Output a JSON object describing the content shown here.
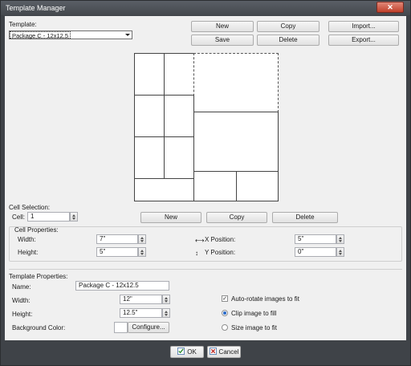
{
  "window": {
    "title": "Template Manager",
    "close_glyph": "✕"
  },
  "template": {
    "label": "Template:",
    "selected": "Package C - 12x12.5",
    "buttons": {
      "new": "New",
      "copy": "Copy",
      "import": "Import...",
      "save": "Save",
      "delete": "Delete",
      "export": "Export..."
    }
  },
  "cell_selection": {
    "label": "Cell Selection:",
    "cell_label": "Cell:",
    "cell_value": "1",
    "buttons": {
      "new": "New",
      "copy": "Copy",
      "delete": "Delete"
    }
  },
  "cell_properties": {
    "label": "Cell Properties:",
    "width_label": "Width:",
    "width_value": "7\"",
    "height_label": "Height:",
    "height_value": "5\"",
    "x_label": "X Position:",
    "x_value": "5\"",
    "y_label": "Y Position:",
    "y_value": "0\""
  },
  "template_properties": {
    "label": "Template Properties:",
    "name_label": "Name:",
    "name_value": "Package C - 12x12.5",
    "width_label": "Width:",
    "width_value": "12\"",
    "height_label": "Height:",
    "height_value": "12.5\"",
    "bg_label": "Background Color:",
    "configure": "Configure...",
    "auto_rotate": "Auto-rotate images to fit",
    "auto_rotate_checked": true,
    "clip": "Clip image to fill",
    "clip_selected": true,
    "size": "Size image to fit",
    "size_selected": false
  },
  "footer": {
    "ok": "OK",
    "cancel": "Cancel"
  },
  "icons": {
    "horizontal-arrows-icon": "⟷",
    "vertical-arrows-icon": "↕",
    "ok-icon": "check",
    "cancel-icon": "x"
  },
  "layout_preview": {
    "selected_cell": 1,
    "cell_count": 11
  }
}
